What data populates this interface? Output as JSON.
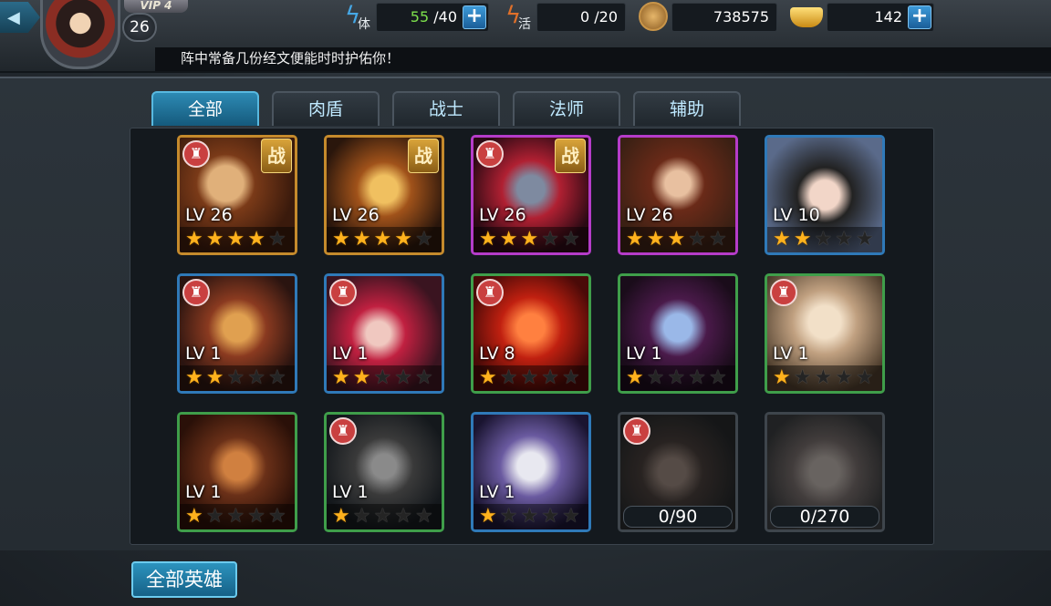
{
  "player": {
    "vip": "VIP 4",
    "level": "26"
  },
  "resources": {
    "stamina": {
      "icon": "lightning-icon",
      "tag": "体",
      "value": "55",
      "max": " /40"
    },
    "vigor": {
      "icon": "lightning-icon",
      "tag": "活",
      "value": "0 /20"
    },
    "coins": {
      "icon": "coin-icon",
      "value": "738575"
    },
    "ingots": {
      "icon": "gold-ingot-icon",
      "value": "142"
    }
  },
  "notice": "阵中常备几份经文便能时时护佑你！",
  "tabs": [
    {
      "label": "全部",
      "active": true
    },
    {
      "label": "肉盾",
      "active": false
    },
    {
      "label": "战士",
      "active": false
    },
    {
      "label": "法师",
      "active": false
    },
    {
      "label": "辅助",
      "active": false
    }
  ],
  "heroes": [
    {
      "level": "LV 26",
      "stars": 4,
      "battle": "战",
      "rarity": "orange",
      "gear": true
    },
    {
      "level": "LV 26",
      "stars": 4,
      "battle": "战",
      "rarity": "orange",
      "gear": false
    },
    {
      "level": "LV 26",
      "stars": 3,
      "battle": "战",
      "rarity": "purple",
      "gear": true
    },
    {
      "level": "LV 26",
      "stars": 3,
      "battle": "",
      "rarity": "purple",
      "gear": false
    },
    {
      "level": "LV 10",
      "stars": 2,
      "battle": "",
      "rarity": "blue",
      "gear": false
    },
    {
      "level": "LV 1",
      "stars": 2,
      "battle": "",
      "rarity": "blue",
      "gear": true
    },
    {
      "level": "LV 1",
      "stars": 2,
      "battle": "",
      "rarity": "blue",
      "gear": true
    },
    {
      "level": "LV 8",
      "stars": 1,
      "battle": "",
      "rarity": "green",
      "gear": true
    },
    {
      "level": "LV 1",
      "stars": 1,
      "battle": "",
      "rarity": "green",
      "gear": false
    },
    {
      "level": "LV 1",
      "stars": 1,
      "battle": "",
      "rarity": "green",
      "gear": true
    },
    {
      "level": "LV 1",
      "stars": 1,
      "battle": "",
      "rarity": "green",
      "gear": false
    },
    {
      "level": "LV 1",
      "stars": 1,
      "battle": "",
      "rarity": "green",
      "gear": true
    },
    {
      "level": "LV 1",
      "stars": 1,
      "battle": "",
      "rarity": "blue",
      "gear": false
    },
    {
      "fragments": "0/90",
      "rarity": "gray",
      "gear": true
    },
    {
      "fragments": "0/270",
      "rarity": "gray",
      "gear": false
    }
  ],
  "star_symbol": "★",
  "gear_symbol": "♜",
  "buttons": {
    "all_heroes": "全部英雄",
    "back": "◀",
    "plus": "+"
  }
}
